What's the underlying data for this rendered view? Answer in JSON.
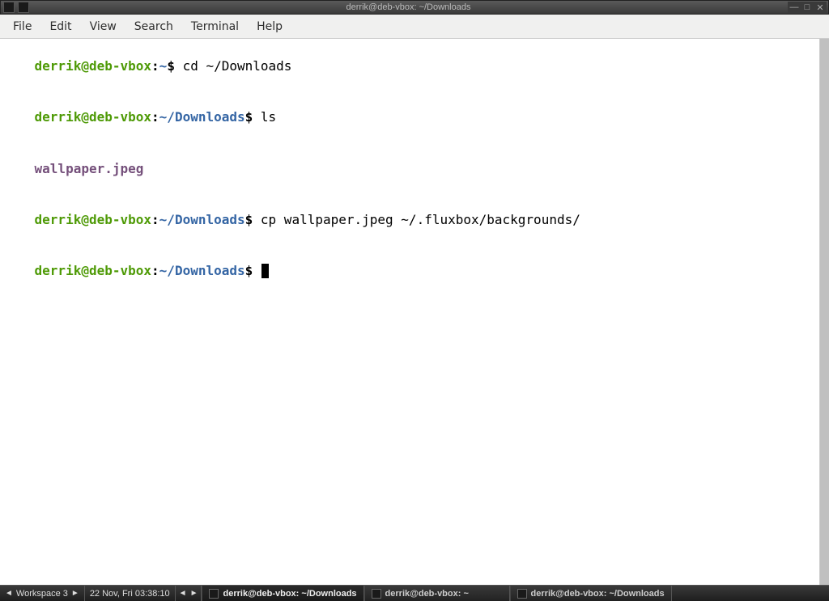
{
  "titlebar": {
    "title": "derrik@deb-vbox: ~/Downloads"
  },
  "menubar": {
    "items": [
      "File",
      "Edit",
      "View",
      "Search",
      "Terminal",
      "Help"
    ]
  },
  "terminal": {
    "lines": [
      {
        "user_host": "derrik@deb-vbox",
        "path": "~",
        "cmd": "cd ~/Downloads"
      },
      {
        "user_host": "derrik@deb-vbox",
        "path": "~/Downloads",
        "cmd": "ls"
      },
      {
        "output": "wallpaper.jpeg"
      },
      {
        "user_host": "derrik@deb-vbox",
        "path": "~/Downloads",
        "cmd": "cp wallpaper.jpeg ~/.fluxbox/backgrounds/"
      },
      {
        "user_host": "derrik@deb-vbox",
        "path": "~/Downloads",
        "cmd": "",
        "cursor": true
      }
    ]
  },
  "taskbar": {
    "workspace_label": "Workspace 3",
    "clock": "22 Nov, Fri 03:38:10",
    "tasks": [
      "derrik@deb-vbox: ~/Downloads",
      "derrik@deb-vbox: ~",
      "derrik@deb-vbox: ~/Downloads"
    ]
  }
}
